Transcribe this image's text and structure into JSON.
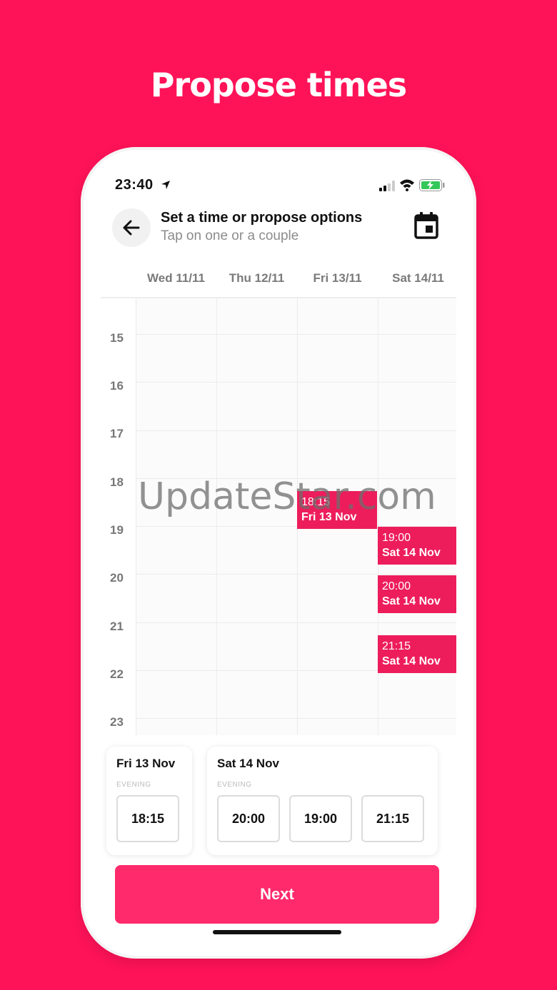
{
  "headline": "Propose times",
  "status_bar": {
    "time": "23:40"
  },
  "header": {
    "title": "Set a time or propose options",
    "subtitle": "Tap on one or a couple"
  },
  "days": [
    "Wed 11/11",
    "Thu 12/11",
    "Fri 13/11",
    "Sat 14/11"
  ],
  "hours": [
    "15",
    "16",
    "17",
    "18",
    "19",
    "20",
    "21",
    "22",
    "23"
  ],
  "events": [
    {
      "time": "18:15",
      "date": "Fri 13 Nov"
    },
    {
      "time": "19:00",
      "date": "Sat 14 Nov"
    },
    {
      "time": "20:00",
      "date": "Sat 14 Nov"
    },
    {
      "time": "21:15",
      "date": "Sat 14 Nov"
    }
  ],
  "watermark": "UpdateStar.com",
  "summary": [
    {
      "title": "Fri 13 Nov",
      "period": "EVENING",
      "slots": [
        "18:15"
      ]
    },
    {
      "title": "Sat 14 Nov",
      "period": "EVENING",
      "slots": [
        "20:00",
        "19:00",
        "21:15"
      ]
    }
  ],
  "next_label": "Next",
  "colors": {
    "brand": "#FF1358",
    "event": "#ED1D5C",
    "button": "#FE2A6B"
  }
}
